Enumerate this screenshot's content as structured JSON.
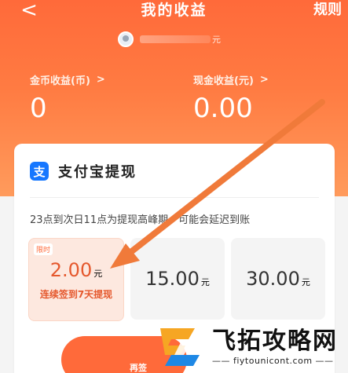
{
  "nav": {
    "back_glyph": "<",
    "title": "我的收益",
    "rules": "规则"
  },
  "user": {
    "masked_suffix": "元"
  },
  "stats": {
    "coins_label": "金币收益(币)",
    "coins_value": "0",
    "cash_label": "现金收益(元)",
    "cash_value": "0.00",
    "chevron": ">"
  },
  "withdraw": {
    "icon_char": "支",
    "title": "支付宝提现",
    "notice": "23点到次日11点为提现高峰期，可能会延迟到账",
    "options": [
      {
        "badge": "限时",
        "amount": "2.00",
        "unit": "元",
        "sub": "连续签到7天提现",
        "active": true
      },
      {
        "amount": "15.00",
        "unit": "元",
        "active": false
      },
      {
        "amount": "30.00",
        "unit": "元",
        "active": false
      }
    ],
    "cta_label": "再签"
  },
  "watermark": {
    "cn": "飞拓攻略网",
    "en": "—— fiytounicont.com ——"
  },
  "colors": {
    "brand_orange": "#ff6a3a",
    "alipay_blue": "#1677ff",
    "arrow": "#f07a3a"
  }
}
